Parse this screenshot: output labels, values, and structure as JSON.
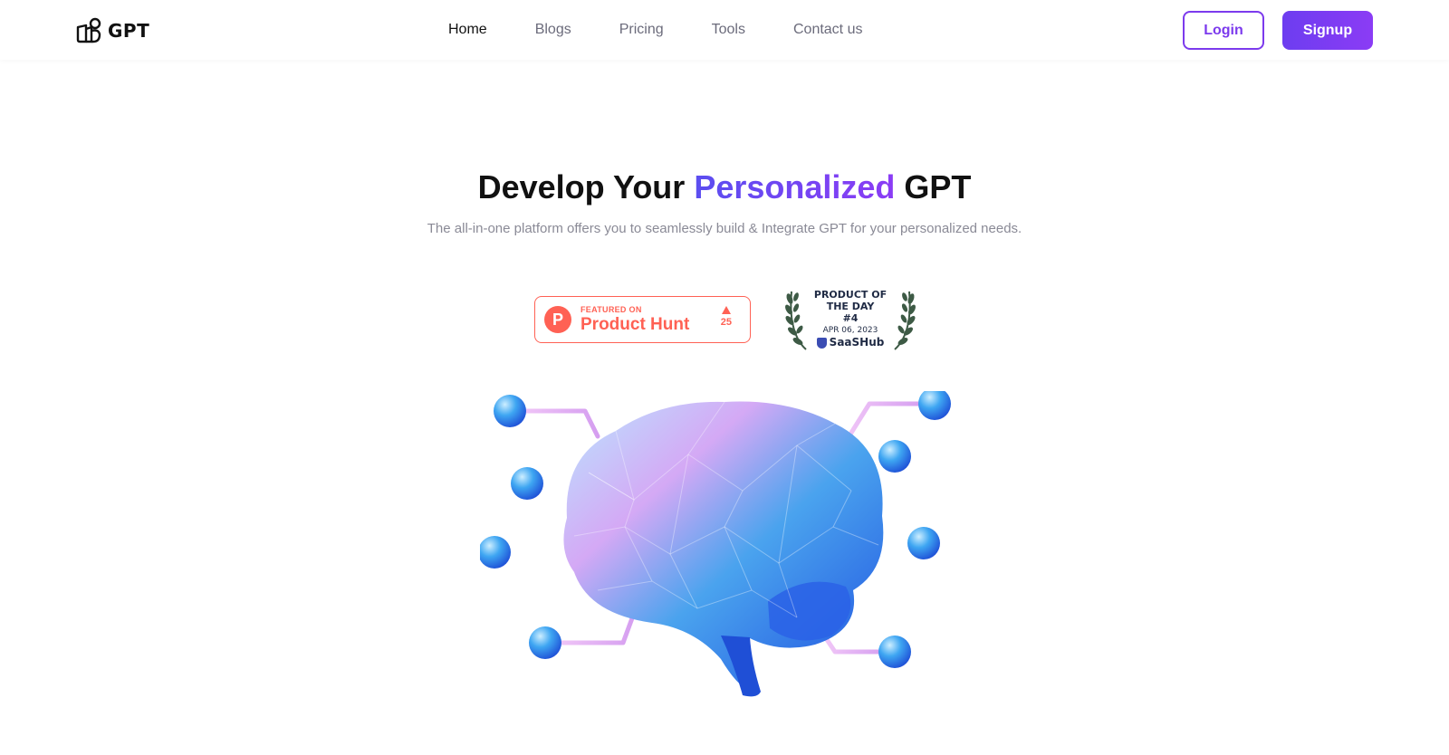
{
  "header": {
    "logo_text": "GPT",
    "nav": [
      {
        "label": "Home",
        "active": true
      },
      {
        "label": "Blogs",
        "active": false
      },
      {
        "label": "Pricing",
        "active": false
      },
      {
        "label": "Tools",
        "active": false
      },
      {
        "label": "Contact us",
        "active": false
      }
    ],
    "login_label": "Login",
    "signup_label": "Signup"
  },
  "hero": {
    "title_pre": "Develop Your ",
    "title_accent": "Personalized",
    "title_post": " GPT",
    "subtitle": "The all-in-one platform offers you to seamlessly build & Integrate GPT for your personalized needs."
  },
  "badges": {
    "product_hunt": {
      "logo_letter": "P",
      "featured_text": "FEATURED ON",
      "name": "Product Hunt",
      "votes": "25"
    },
    "saashub": {
      "line1": "PRODUCT OF",
      "line2": "THE DAY",
      "rank": "#4",
      "date": "APR 06, 2023",
      "brand": "SaaSHub"
    }
  },
  "colors": {
    "accent": "#7c3aed",
    "product_hunt": "#ff6154",
    "brain": "#2f6ff0"
  },
  "illustration": {
    "icon": "brain-network-icon"
  }
}
